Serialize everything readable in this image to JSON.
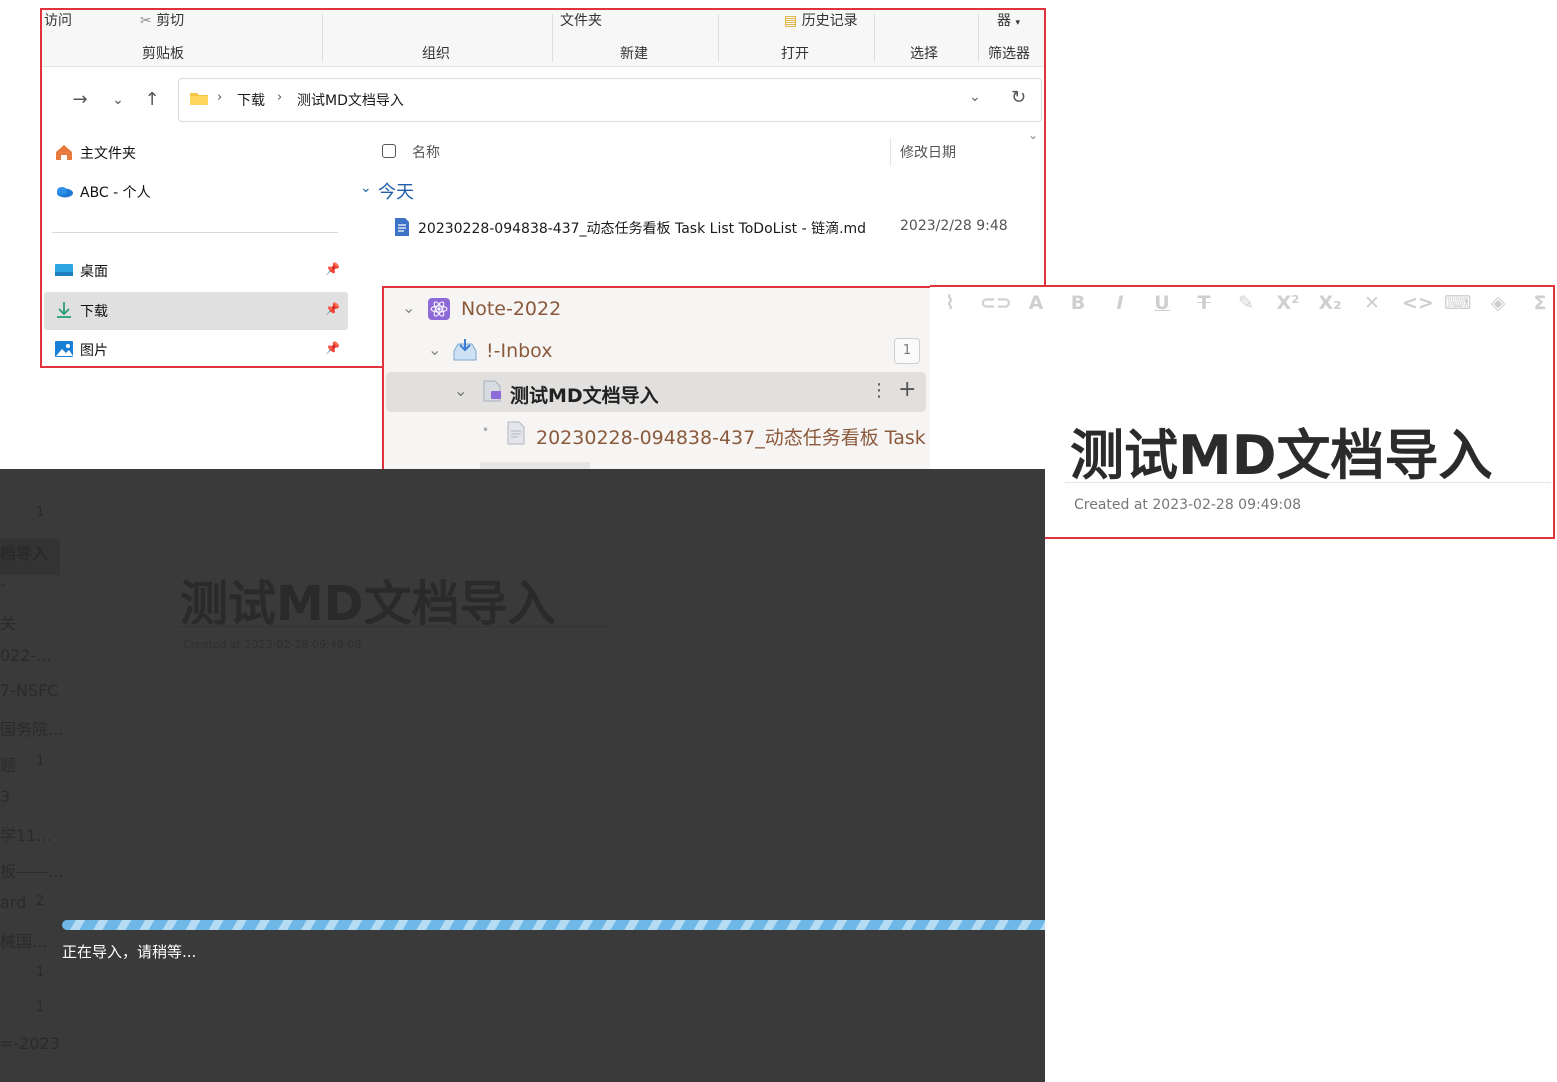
{
  "explorer": {
    "ribbon_top": {
      "access": "访问",
      "cut": "剪切",
      "folder": "文件夹",
      "history": "历史记录",
      "filter_partial": "器"
    },
    "ribbon_groups": [
      "剪贴板",
      "组织",
      "新建",
      "打开",
      "选择",
      "筛选器"
    ],
    "breadcrumb": [
      "下载",
      "测试MD文档导入"
    ],
    "sidebar": [
      {
        "label": "主文件夹",
        "icon": "home-icon"
      },
      {
        "label": "ABC - 个人",
        "icon": "onedrive-icon"
      },
      {
        "label": "桌面",
        "icon": "desktop-icon",
        "pinned": true
      },
      {
        "label": "下载",
        "icon": "download-icon",
        "pinned": true,
        "selected": true
      },
      {
        "label": "图片",
        "icon": "pictures-icon",
        "pinned": true
      }
    ],
    "columns": {
      "name": "名称",
      "modified": "修改日期"
    },
    "group": "今天",
    "file": {
      "name": "20230228-094838-437_动态任务看板 Task List ToDoList - 链滴.md",
      "date": "2023/2/28 9:48"
    }
  },
  "tree": {
    "notebook": "Note-2022",
    "inbox": "!-Inbox",
    "inbox_count": "1",
    "doc": "测试MD文档导入",
    "child": "20230228-094838-437_动态任务看板 Task ..."
  },
  "editor": {
    "title": "测试MD文档导入",
    "created": "Created at 2023-02-28 09:49:08"
  },
  "overlay": {
    "sidebar_fragments": [
      "档导入",
      "-",
      "关",
      "022-...",
      "7-NSFC",
      "国务院...",
      "题",
      "3",
      "学11...",
      "板——...",
      "ard",
      "械国...",
      "",
      "",
      "=-2023"
    ],
    "sidebar_numbers": [
      "1",
      "1",
      "2",
      "1",
      "1"
    ],
    "title": "测试MD文档导入",
    "created": "Created at 2023-02-28 09:49:08",
    "status": "正在导入，请稍等..."
  }
}
